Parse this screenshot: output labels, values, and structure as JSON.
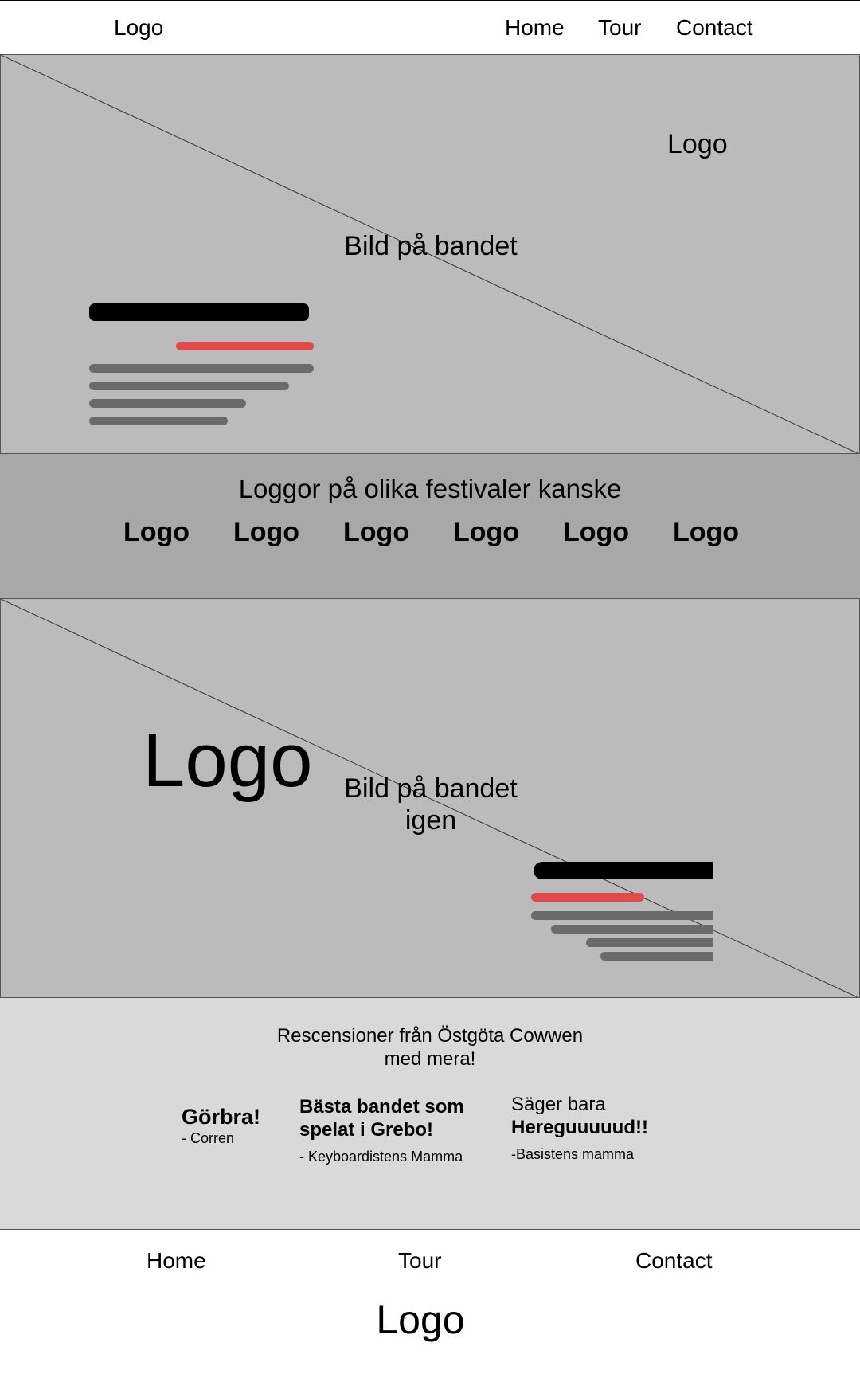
{
  "header": {
    "logo": "Logo",
    "nav": [
      "Home",
      "Tour",
      "Contact"
    ]
  },
  "hero1": {
    "logo": "Logo",
    "image_label": "Bild på bandet"
  },
  "logos_band": {
    "title": "Loggor på olika festivaler kanske",
    "logos": [
      "Logo",
      "Logo",
      "Logo",
      "Logo",
      "Logo",
      "Logo"
    ]
  },
  "hero2": {
    "logo": "Logo",
    "image_label_line1": "Bild på bandet",
    "image_label_line2": "igen"
  },
  "reviews": {
    "title_line1": "Rescensioner från Östgöta Cowwen",
    "title_line2": "med mera!",
    "items": [
      {
        "quote": "Görbra!",
        "author": "- Corren"
      },
      {
        "quote_line1": "Bästa bandet som",
        "quote_line2": "spelat i Grebo!",
        "author": "- Keyboardistens Mamma"
      },
      {
        "quote_line1": "Säger bara",
        "quote_line2": "Hereguuuuud!!",
        "author": "-Basistens mamma"
      }
    ]
  },
  "footer": {
    "nav": [
      "Home",
      "Tour",
      "Contact"
    ],
    "logo": "Logo"
  },
  "colors": {
    "accent": "#e04a4a",
    "hero_bg": "#bbbbbb",
    "band_bg": "#a8a8a8",
    "reviews_bg": "#d9d9d9"
  }
}
